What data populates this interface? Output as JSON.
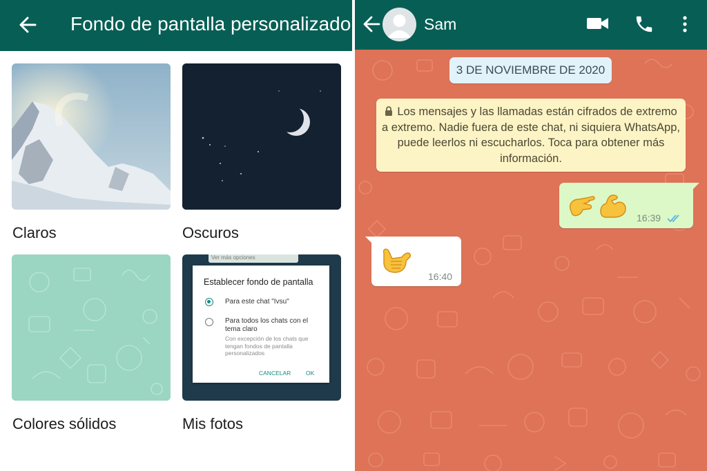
{
  "settings": {
    "title": "Fondo de pantalla personalizado",
    "categories": [
      {
        "label": "Claros"
      },
      {
        "label": "Oscuros"
      },
      {
        "label": "Colores sólidos"
      },
      {
        "label": "Mis fotos"
      }
    ],
    "preview_dialog": {
      "peek_text": "Ver más opciones",
      "title": "Establecer fondo de pantalla",
      "option1": "Para este chat \"Ivsu\"",
      "option2": "Para todos los chats con el tema claro",
      "option2_sub": "Con excepción de los chats que tengan fondos de pantalla personalizados",
      "cancel": "CANCELAR",
      "ok": "OK"
    }
  },
  "chat": {
    "contact_name": "Sam",
    "date_chip": "3 DE NOVIEMBRE DE 2020",
    "system_message": "Los mensajes y las llamadas están cifrados de extremo a extremo. Nadie fuera de este chat, ni siquiera WhatsApp, puede leerlos ni escucharlos. Toca para obtener más información.",
    "messages": [
      {
        "direction": "outgoing",
        "content": "pinching-hand-flexed-biceps-emoji",
        "time": "16:39",
        "status": "read"
      },
      {
        "direction": "incoming",
        "content": "call-me-hand-emoji",
        "time": "16:40"
      }
    ]
  },
  "colors": {
    "header": "#075e54",
    "chat_wallpaper": "#de7358",
    "solid_tile": "#9ad6c1",
    "outgoing_bubble": "#dcf8c6",
    "system_message": "#fdf4c5",
    "date_chip": "#e1f2fb",
    "read_ticks": "#4fb6ec"
  }
}
